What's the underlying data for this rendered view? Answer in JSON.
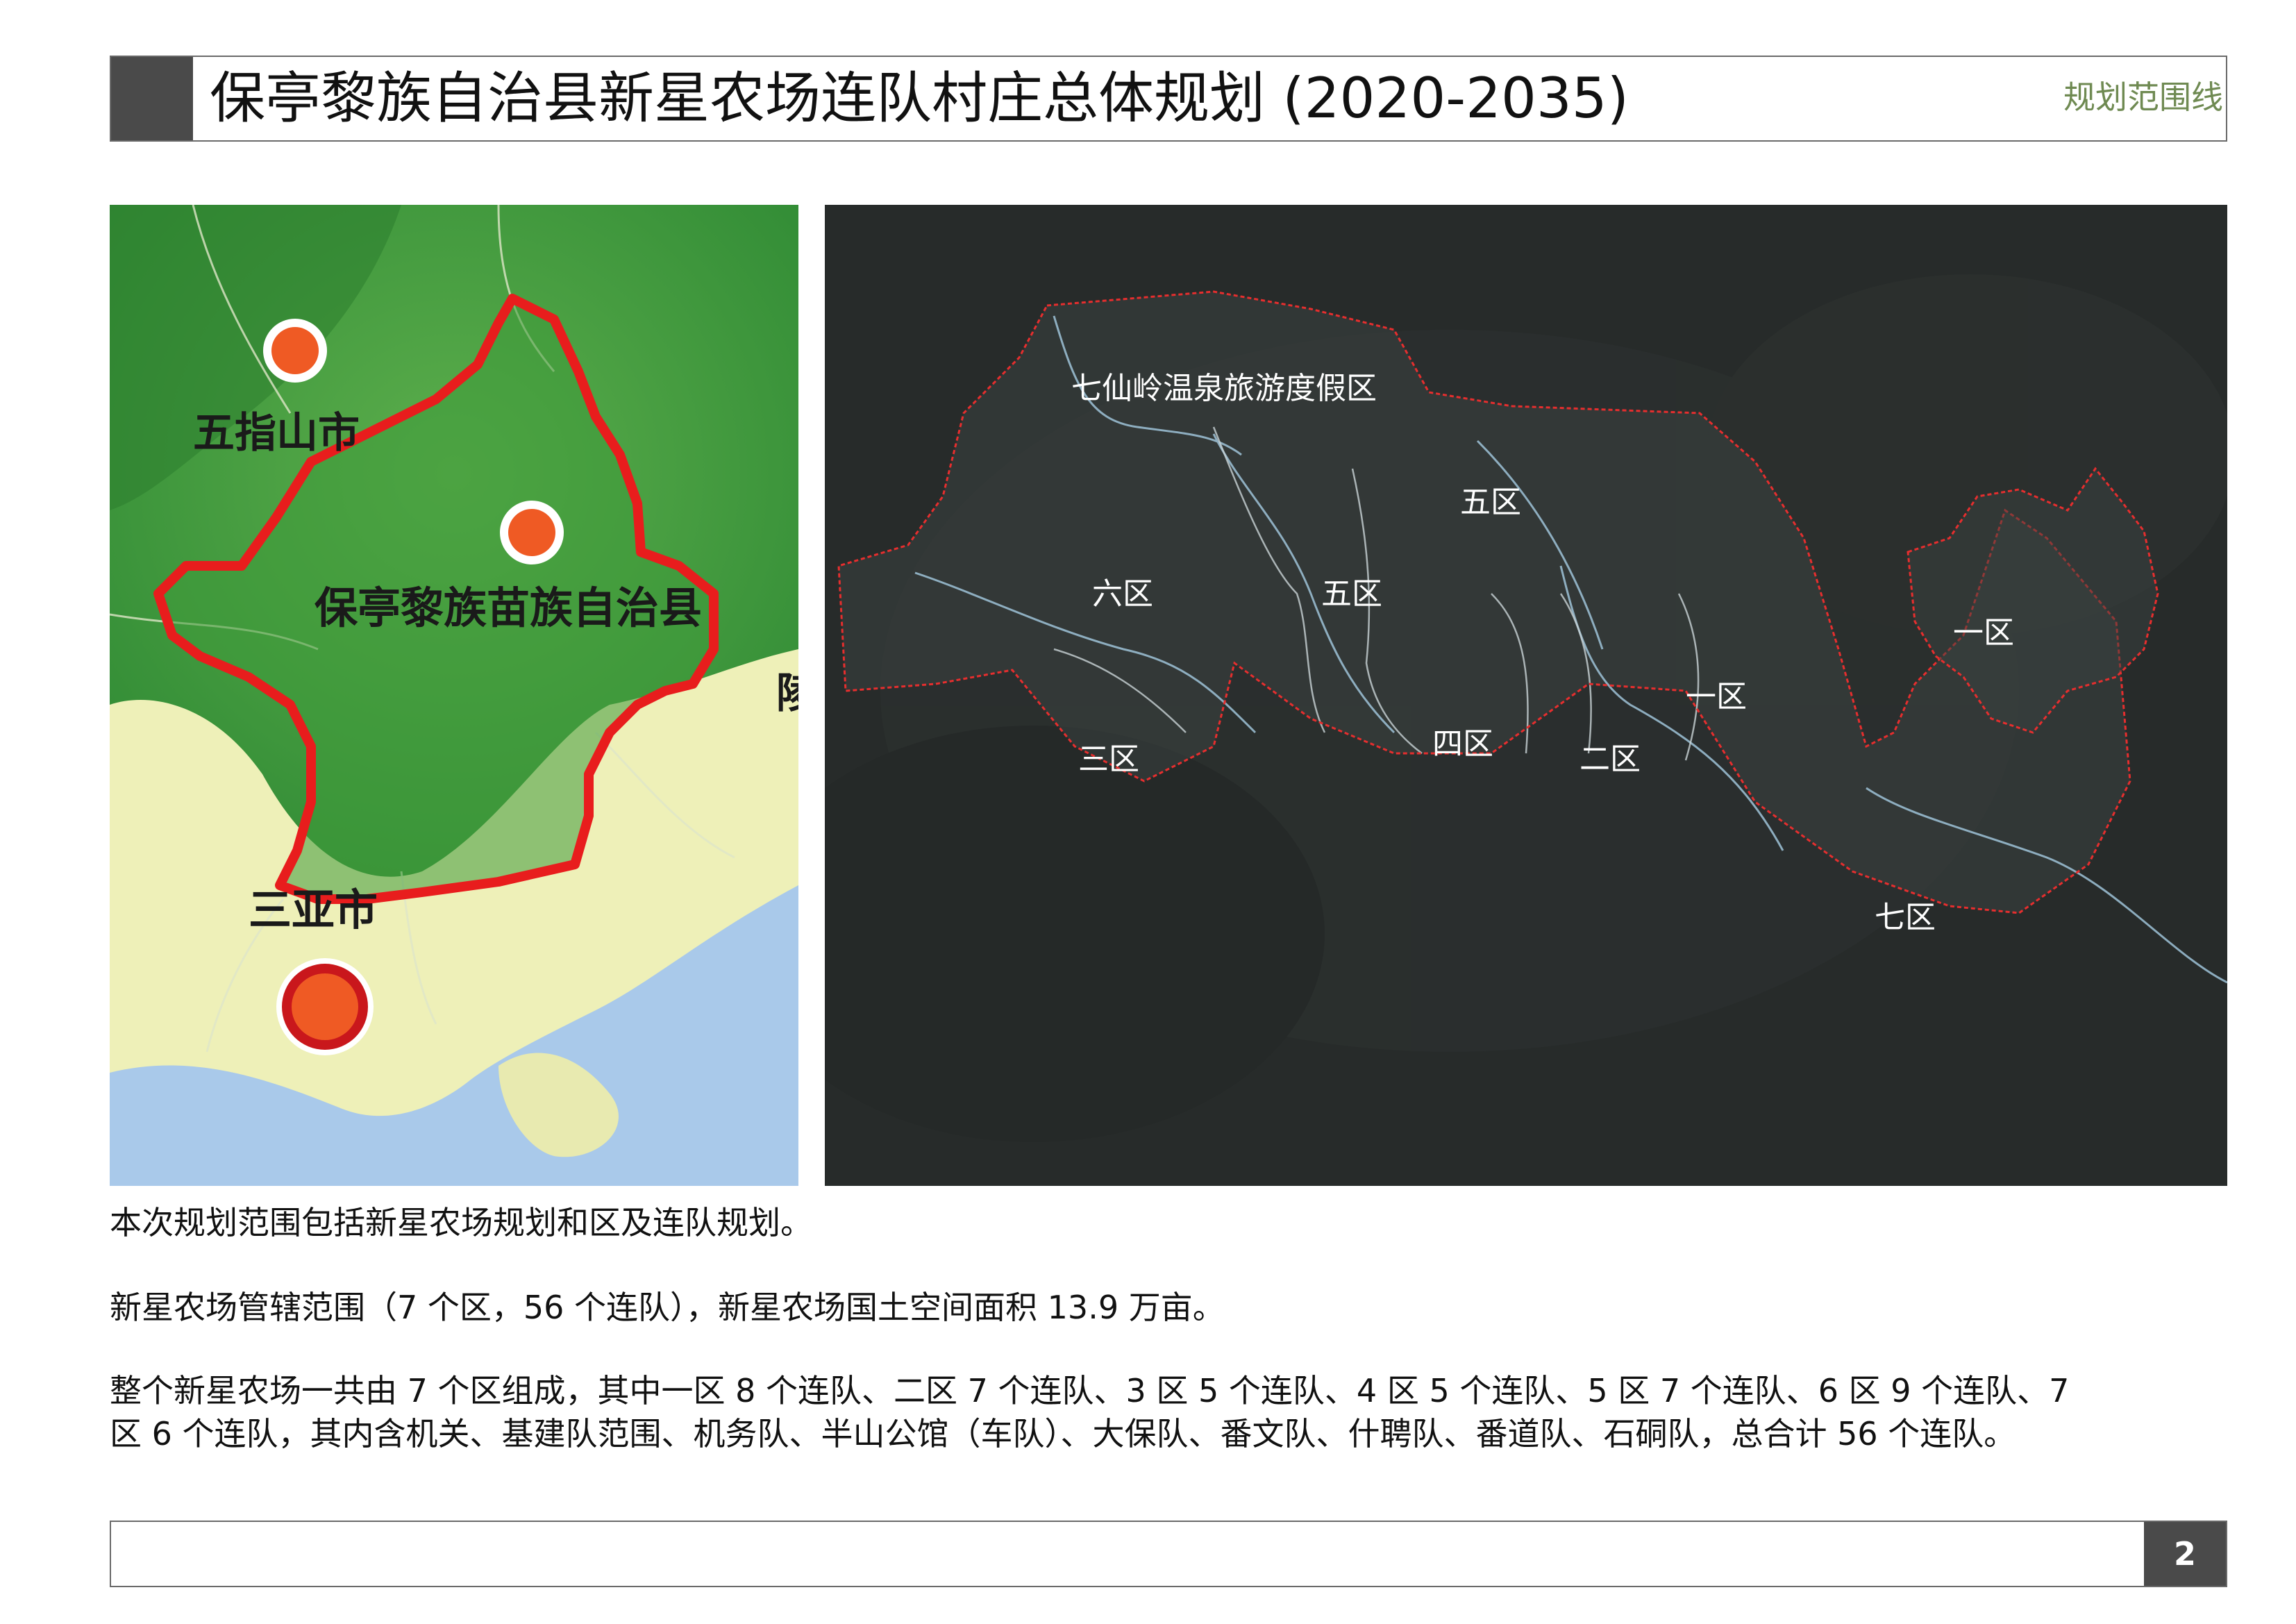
{
  "header": {
    "title": "保亭黎族自治县新星农场连队村庄总体规划 (2020-2035)",
    "tag": "规划范围线"
  },
  "location_map": {
    "labels": {
      "wuzhishan": "五指山市",
      "baoting": "保亭黎族苗族自治县",
      "sanya": "三亚市",
      "edge": "陵"
    },
    "colors": {
      "land": "#eef0b8",
      "forest": "#3f9a3a",
      "sea": "#a9c9ea",
      "boundary": "#e81d1d",
      "city_marker": "#ef5a24"
    }
  },
  "zone_map": {
    "zones": {
      "resort": "七仙岭温泉旅游度假区",
      "zone5_north": "五区",
      "zone6": "六区",
      "zone5_center": "五区",
      "zone3": "三区",
      "zone4": "四区",
      "zone2": "二区",
      "zone1_center": "一区",
      "zone1_east": "一区",
      "zone7": "七区"
    },
    "colors": {
      "background": "#272b2a",
      "boundary": "#e62e2e",
      "river": "#9fc3d8"
    }
  },
  "description": {
    "p1": "本次规划范围包括新星农场规划和区及连队规划。",
    "p2": "新星农场管辖范围（7 个区，56 个连队），新星农场国土空间面积 13.9 万亩。",
    "p3_line1": "整个新星农场一共由 7 个区组成，其中一区 8 个连队、二区 7 个连队、3 区 5 个连队、4 区 5 个连队、5 区 7 个连队、6 区 9 个连队、7",
    "p3_line2": "区 6 个连队，其内含机关、基建队范围、机务队、半山公馆（车队）、大保队、番文队、什聘队、番道队、石硐队，总合计 56 个连队。"
  },
  "footer": {
    "page_number": "2"
  }
}
